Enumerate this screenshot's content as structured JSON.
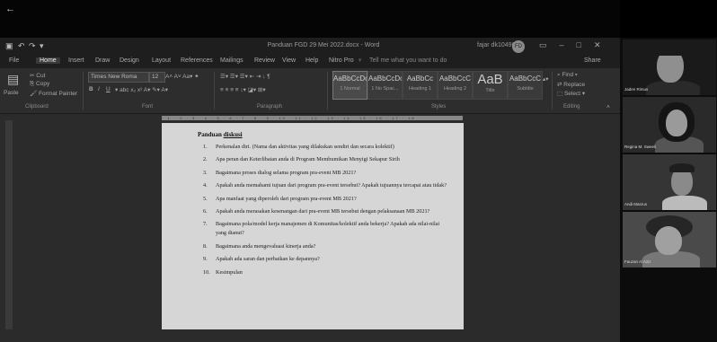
{
  "window": {
    "back_icon": "←",
    "doc_title": "Panduan FGD 29 Mei 2022.docx - Word",
    "user_name": "fajar dk10496t",
    "user_initials": "FD"
  },
  "menu_tabs": [
    "File",
    "Home",
    "Insert",
    "Draw",
    "Design",
    "Layout",
    "References",
    "Mailings",
    "Review",
    "View",
    "Help",
    "Nitro Pro"
  ],
  "active_tab": "Home",
  "tell_me": "Tell me what you want to do",
  "share": "Share",
  "ribbon": {
    "clipboard": {
      "paste": "Paste",
      "cut": "Cut",
      "copy": "Copy",
      "format_painter": "Format Painter",
      "label": "Clipboard"
    },
    "font": {
      "name": "Times New Roma",
      "size": "12",
      "label": "Font",
      "bold": "B",
      "italic": "I",
      "underline": "U"
    },
    "paragraph": {
      "label": "Paragraph"
    },
    "styles": {
      "label": "Styles",
      "items": [
        {
          "preview": "AaBbCcDc",
          "name": "1 Normal"
        },
        {
          "preview": "AaBbCcDc",
          "name": "1 No Spac..."
        },
        {
          "preview": "AaBbCc",
          "name": "Heading 1"
        },
        {
          "preview": "AaBbCcC",
          "name": "Heading 2"
        },
        {
          "preview": "AaB",
          "name": "Title"
        },
        {
          "preview": "AaBbCcC",
          "name": "Subtitle"
        }
      ]
    },
    "editing": {
      "find": "Find",
      "replace": "Replace",
      "select": "Select",
      "label": "Editing"
    }
  },
  "document": {
    "heading_prefix": "Panduan",
    "heading_word": "diskusi",
    "items": [
      {
        "num": "1.",
        "text": "Perkenalan diri. (Nama dan aktivitas yang dilakukan sendiri dan secara kolektif)"
      },
      {
        "num": "2.",
        "text": "Apa peran dan Keterlibatan anda di Program Membumikan Menyigi Sekapur Sirih"
      },
      {
        "num": "3.",
        "text": "Bagaimana proses dialog selama program pra-event MB 2021?"
      },
      {
        "num": "4.",
        "text": "Apakah anda memahami tujuan dari program pra-event tersebut? Apakah tujuannya tercapai atau tidak?"
      },
      {
        "num": "5.",
        "text": "Apa manfaat yang diperoleh dari program pra-event MB 2021?"
      },
      {
        "num": "6.",
        "text": "Apakah anda merasakan kesenangan dari pra-event MB tersebut dengan pelaksanaan MB 2021?"
      },
      {
        "num": "7.",
        "text": "Bagaimana pola/model kerja manajemen di Komunitas/kolektif anda bekerja? Apakah ada nilai-nilai yang dianut?"
      },
      {
        "num": "8.",
        "text": "Bagaimana anda mengevaluasi kinerja anda?"
      },
      {
        "num": "9.",
        "text": "Apakah ada saran dan perbaikan ke depannya?"
      },
      {
        "num": "10.",
        "text": "Kesimpulan"
      }
    ]
  },
  "participants": [
    {
      "name": "Jaden Rimus"
    },
    {
      "name": "Regina M. Sweeli"
    },
    {
      "name": "Andi Masrus"
    },
    {
      "name": "Fauzan Al Aziz"
    }
  ]
}
